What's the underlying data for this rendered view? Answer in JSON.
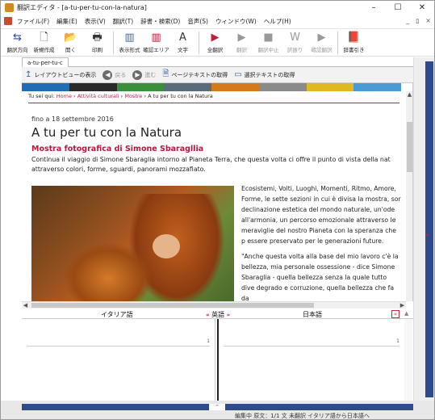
{
  "window": {
    "title": "翻訳エディタ - [a-tu-per-tu-con-la-natura]",
    "minimize": "–",
    "maximize": "☐",
    "close": "✕"
  },
  "menubar": {
    "items": [
      "ファイル(F)",
      "編集(E)",
      "表示(V)",
      "翻訳(T)",
      "辞書・検索(D)",
      "音声(S)",
      "ウィンドウ(W)",
      "ヘルプ(H)"
    ],
    "mdi_min": "_",
    "mdi_restore": "ﾛ",
    "mdi_close": "×"
  },
  "toolbar": {
    "buttons": [
      {
        "label": "翻訳方向",
        "glyph": "⇆",
        "disabled": false
      },
      {
        "label": "新規作成",
        "glyph": "🗋",
        "disabled": false
      },
      {
        "label": "開く",
        "glyph": "📂",
        "disabled": false
      },
      {
        "label": "印刷",
        "glyph": "🖶",
        "disabled": false
      },
      {
        "label": "表示形式",
        "glyph": "▥",
        "disabled": false
      },
      {
        "label": "確認エリア",
        "glyph": "▥",
        "disabled": false
      },
      {
        "label": "文字",
        "glyph": "A",
        "disabled": false
      },
      {
        "label": "全翻訳",
        "glyph": "▶",
        "disabled": false
      },
      {
        "label": "翻訳",
        "glyph": "▶",
        "disabled": true
      },
      {
        "label": "翻訳中止",
        "glyph": "■",
        "disabled": true
      },
      {
        "label": "訳振り",
        "glyph": "W",
        "disabled": true
      },
      {
        "label": "確認翻訳",
        "glyph": "▶",
        "disabled": true
      },
      {
        "label": "辞書引き",
        "glyph": "📕",
        "disabled": false
      }
    ]
  },
  "tabs": {
    "active": "a-tu-per-tu-c"
  },
  "nav": {
    "layout_view": "レイアウトビューの表示",
    "back": "戻る",
    "forward": "進む",
    "get_page_text": "ページテキストの取得",
    "get_selected_text": "選択テキストの取得"
  },
  "page": {
    "breadcrumb_prefix": "Tu sei qui:",
    "breadcrumb_links": [
      "Home",
      "Attività culturali",
      "Mostre"
    ],
    "breadcrumb_current": "A tu per tu con la Natura",
    "date": "fino a 18 settembre 2016",
    "title": "A tu per tu con la Natura",
    "subtitle": "Mostra fotografica di Simone Sbaragllia",
    "intro": "Continua il viaggio di Simone Sbaraglia intorno al Pianeta Terra, che questa volta ci offre il punto di vista della nat attraverso colori, forme, sguardi, panorami mozzafiato.",
    "para1": "Ecosistemi, Volti, Luoghi, Momenti, Ritmo, Amore, Forme, le sette sezioni in cui è divisa la mostra, sor declinazione estetica del mondo naturale, un'ode all'armonia, un percorso emozionale attraverso le meraviglie del nostro Pianeta con la speranza che p essere preservato per le generazioni future.",
    "para2": "\"Anche questa volta alla base del mio lavoro c'è la bellezza, mia personale ossessione - dice Simone Sbaraglia - quella bellezza senza la quale tutto dive degrado e corruzione, quella bellezza che fa da"
  },
  "translation": {
    "italian_header": "イタリア語",
    "english_header": "英語",
    "japanese_header": "日本語",
    "row_number": "1"
  },
  "status": {
    "text": "編集中  原文：1/1 文  未翻訳  イタリア語から日本語へ"
  },
  "colors": {
    "accent": "#c01e4a",
    "strip": [
      "#1f6db3",
      "#2a2a2a",
      "#3a8f3a",
      "#5a6b7a",
      "#d47a1a",
      "#8a8a8a",
      "#e0b820",
      "#4a9ad4"
    ]
  }
}
